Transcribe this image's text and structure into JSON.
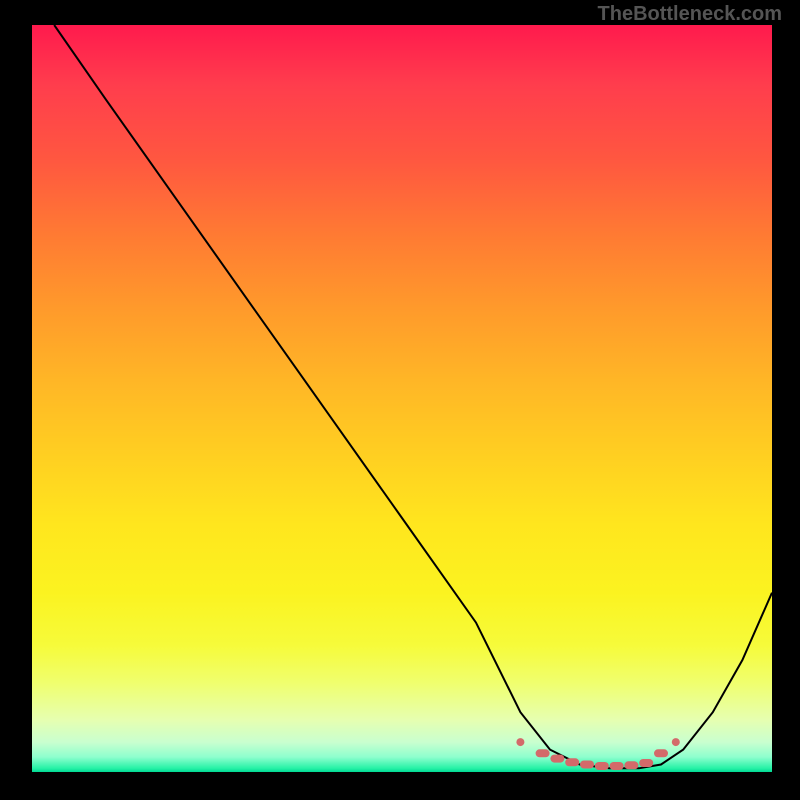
{
  "watermark": "TheBottleneck.com",
  "chart_data": {
    "type": "line",
    "title": "",
    "xlabel": "",
    "ylabel": "",
    "xlim": [
      0,
      100
    ],
    "ylim": [
      0,
      100
    ],
    "series": [
      {
        "name": "black-curve",
        "x": [
          3,
          10,
          20,
          30,
          40,
          50,
          60,
          66,
          70,
          74,
          78,
          82,
          85,
          88,
          92,
          96,
          100
        ],
        "values": [
          100,
          90,
          76,
          62,
          48,
          34,
          20,
          8,
          3,
          1,
          0.5,
          0.5,
          1,
          3,
          8,
          15,
          24
        ]
      },
      {
        "name": "pink-markers",
        "x": [
          66,
          69,
          71,
          73,
          75,
          77,
          79,
          81,
          83,
          85,
          87
        ],
        "values": [
          4,
          2.5,
          1.8,
          1.3,
          1.0,
          0.8,
          0.8,
          0.9,
          1.2,
          2.5,
          4
        ]
      }
    ],
    "background_gradient": {
      "top": "#ff1a4d",
      "bottom": "#00d894"
    }
  }
}
